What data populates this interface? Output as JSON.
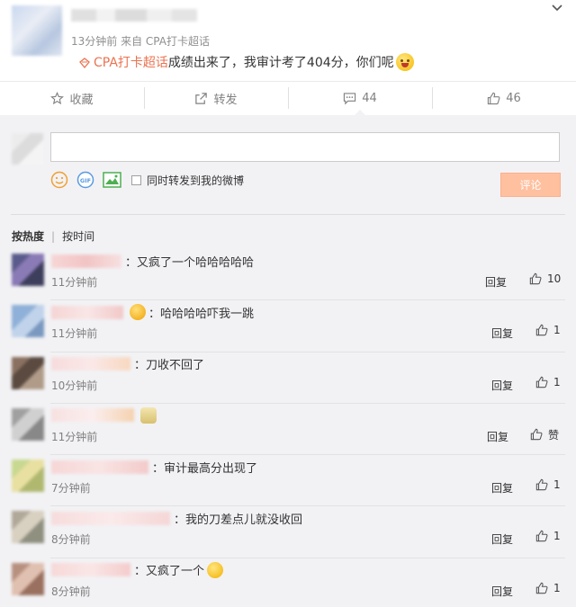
{
  "post": {
    "meta": "13分钟前 来自 CPA打卡超话",
    "topic_tag": "CPA打卡超话",
    "text": "成绩出来了，我审计考了404分，你们呢"
  },
  "actions": {
    "favorite": "收藏",
    "repost": "转发",
    "comments": "44",
    "likes": "46"
  },
  "composer": {
    "repost_option": "同时转发到我的微博",
    "submit": "评论"
  },
  "sort": {
    "hot": "按热度",
    "time": "按时间"
  },
  "comments": [
    {
      "text": "：又疯了一个哈哈哈哈哈",
      "time": "11分钟前",
      "reply": "回复",
      "likes": "10"
    },
    {
      "text": "：哈哈哈哈吓我一跳",
      "time": "11分钟前",
      "reply": "回复",
      "likes": "1"
    },
    {
      "text": "：刀收不回了",
      "time": "10分钟前",
      "reply": "回复",
      "likes": "1"
    },
    {
      "text": "",
      "time": "11分钟前",
      "reply": "回复",
      "likes": "赞"
    },
    {
      "text": "：审计最高分出现了",
      "time": "7分钟前",
      "reply": "回复",
      "likes": "1"
    },
    {
      "text": "：我的刀差点儿就没收回",
      "time": "8分钟前",
      "reply": "回复",
      "likes": "1"
    },
    {
      "text": "：又疯了一个",
      "time": "8分钟前",
      "reply": "回复",
      "likes": "1"
    }
  ],
  "colors": {
    "accent": "#eb7350",
    "submit_bg": "#ffc09f",
    "panel_bg": "#f2f2f5"
  }
}
